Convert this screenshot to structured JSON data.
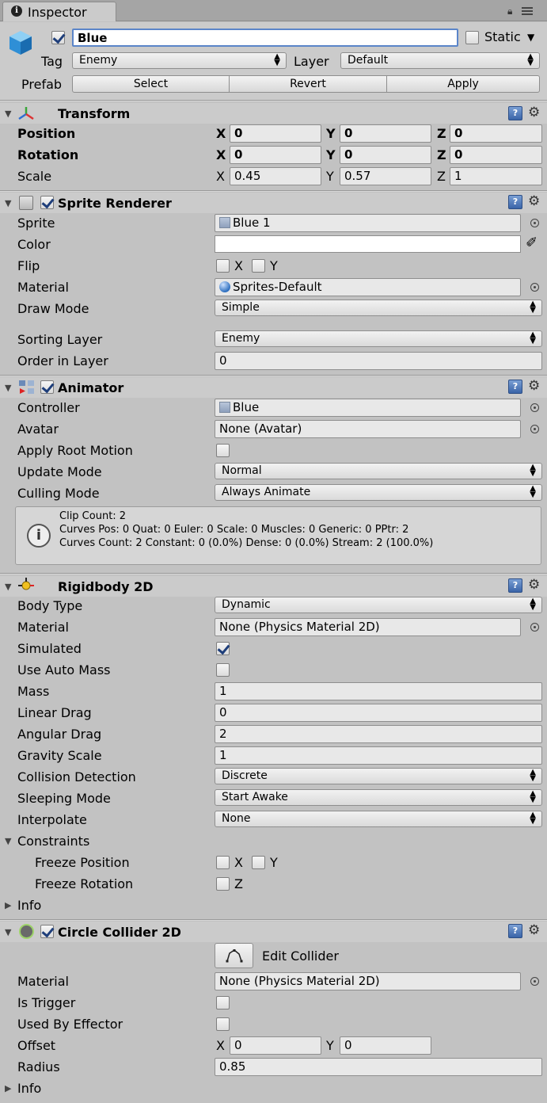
{
  "window": {
    "tab_label": "Inspector",
    "info_glyph": "i"
  },
  "gameobject": {
    "name": "Blue",
    "active": true,
    "static_label": "Static",
    "tag_label": "Tag",
    "tag_value": "Enemy",
    "layer_label": "Layer",
    "layer_value": "Default",
    "prefab_label": "Prefab",
    "prefab_buttons": [
      "Select",
      "Revert",
      "Apply"
    ]
  },
  "help_glyph": "?",
  "transform": {
    "title": "Transform",
    "position_label": "Position",
    "position": {
      "x": "0",
      "y": "0",
      "z": "0"
    },
    "rotation_label": "Rotation",
    "rotation": {
      "x": "0",
      "y": "0",
      "z": "0"
    },
    "scale_label": "Scale",
    "scale": {
      "x": "0.45",
      "y": "0.57",
      "z": "1"
    },
    "axes": {
      "x": "X",
      "y": "Y",
      "z": "Z"
    }
  },
  "sprite_renderer": {
    "title": "Sprite Renderer",
    "enabled": true,
    "sprite_label": "Sprite",
    "sprite_value": "Blue 1",
    "color_label": "Color",
    "color_value": "#ffffff",
    "flip_label": "Flip",
    "flip_x": "X",
    "flip_y": "Y",
    "material_label": "Material",
    "material_value": "Sprites-Default",
    "draw_mode_label": "Draw Mode",
    "draw_mode_value": "Simple",
    "sorting_layer_label": "Sorting Layer",
    "sorting_layer_value": "Enemy",
    "order_label": "Order in Layer",
    "order_value": "0"
  },
  "animator": {
    "title": "Animator",
    "enabled": true,
    "controller_label": "Controller",
    "controller_value": "Blue",
    "avatar_label": "Avatar",
    "avatar_value": "None (Avatar)",
    "root_motion_label": "Apply Root Motion",
    "update_mode_label": "Update Mode",
    "update_mode_value": "Normal",
    "culling_mode_label": "Culling Mode",
    "culling_mode_value": "Always Animate",
    "info_lines": [
      "Clip Count: 2",
      "Curves Pos: 0 Quat: 0 Euler: 0 Scale: 0 Muscles: 0 Generic: 0 PPtr: 2",
      "Curves Count: 2 Constant: 0 (0.0%) Dense: 0 (0.0%) Stream: 2 (100.0%)"
    ]
  },
  "rigidbody2d": {
    "title": "Rigidbody 2D",
    "body_type_label": "Body Type",
    "body_type_value": "Dynamic",
    "material_label": "Material",
    "material_value": "None (Physics Material 2D)",
    "simulated_label": "Simulated",
    "simulated": true,
    "auto_mass_label": "Use Auto Mass",
    "auto_mass": false,
    "mass_label": "Mass",
    "mass_value": "1",
    "linear_drag_label": "Linear Drag",
    "linear_drag_value": "0",
    "angular_drag_label": "Angular Drag",
    "angular_drag_value": "2",
    "gravity_label": "Gravity Scale",
    "gravity_value": "1",
    "collision_label": "Collision Detection",
    "collision_value": "Discrete",
    "sleeping_label": "Sleeping Mode",
    "sleeping_value": "Start Awake",
    "interpolate_label": "Interpolate",
    "interpolate_value": "None",
    "constraints_label": "Constraints",
    "freeze_pos_label": "Freeze Position",
    "freeze_pos_x": "X",
    "freeze_pos_y": "Y",
    "freeze_rot_label": "Freeze Rotation",
    "freeze_rot_z": "Z",
    "info_label": "Info"
  },
  "circle_collider": {
    "title": "Circle Collider 2D",
    "enabled": true,
    "edit_label": "Edit Collider",
    "material_label": "Material",
    "material_value": "None (Physics Material 2D)",
    "trigger_label": "Is Trigger",
    "effector_label": "Used By Effector",
    "offset_label": "Offset",
    "offset": {
      "x": "0",
      "y": "0"
    },
    "radius_label": "Radius",
    "radius_value": "0.85",
    "info_label": "Info"
  }
}
